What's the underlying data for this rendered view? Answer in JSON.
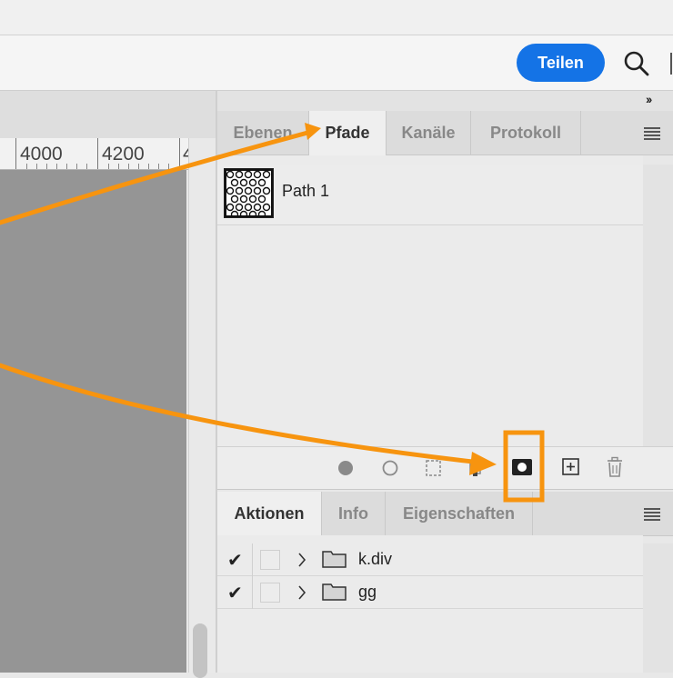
{
  "toolbar": {
    "share_label": "Teilen"
  },
  "collapse_glyph": "››",
  "ruler": {
    "labels": [
      "4000",
      "4200",
      "4"
    ]
  },
  "paths_panel": {
    "tabs": [
      {
        "label": "Ebenen",
        "active": false
      },
      {
        "label": "Pfade",
        "active": true
      },
      {
        "label": "Kanäle",
        "active": false
      },
      {
        "label": "Protokoll",
        "active": false
      }
    ],
    "paths": [
      {
        "name": "Path 1"
      }
    ],
    "footer_icons": [
      "fill-path-icon",
      "stroke-path-icon",
      "load-selection-icon",
      "make-work-path-icon",
      "add-mask-icon",
      "new-path-icon",
      "delete-icon"
    ]
  },
  "actions_panel": {
    "tabs": [
      {
        "label": "Aktionen",
        "active": true
      },
      {
        "label": "Info",
        "active": false
      },
      {
        "label": "Eigenschaften",
        "active": false
      }
    ],
    "rows": [
      {
        "check": "✔",
        "name": "k.div"
      },
      {
        "check": "✔",
        "name": "gg"
      }
    ]
  },
  "annotation": {
    "color": "#f7940f",
    "highlight": "add-mask-icon"
  },
  "colors": {
    "accent": "#1473e6",
    "canvas": "#959595"
  }
}
